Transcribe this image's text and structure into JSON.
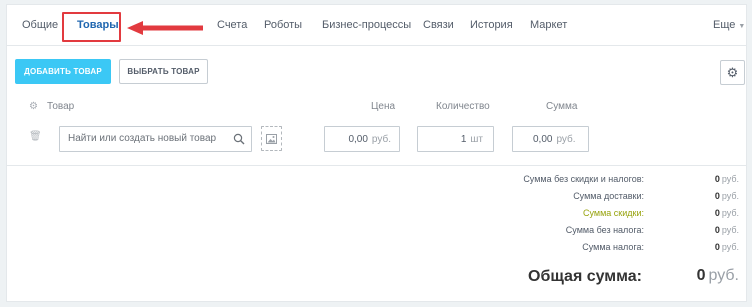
{
  "tabs": [
    {
      "label": "Общие",
      "active": false
    },
    {
      "label": "Товары",
      "active": true
    },
    {
      "label": "Счета",
      "active": false
    },
    {
      "label": "Роботы",
      "active": false
    },
    {
      "label": "Бизнес-процессы",
      "active": false
    },
    {
      "label": "Связи",
      "active": false
    },
    {
      "label": "История",
      "active": false
    },
    {
      "label": "Маркет",
      "active": false
    }
  ],
  "more_tab": {
    "label": "Еще",
    "icon": "caret-down-icon"
  },
  "annotation": {
    "highlight_color": "#e23a3f",
    "arrow_color": "#e23a3f"
  },
  "toolbar": {
    "add_label": "ДОБАВИТЬ ТОВАР",
    "select_label": "ВЫБРАТЬ ТОВАР",
    "settings_icon": "gear-icon"
  },
  "columns": {
    "product": "Товар",
    "price": "Цена",
    "quantity": "Количество",
    "sum": "Сумма"
  },
  "row": {
    "search_placeholder": "Найти или создать новый товар",
    "price": "0,00",
    "price_unit": "руб.",
    "quantity": "1",
    "quantity_unit": "шт",
    "sum": "0,00",
    "sum_unit": "руб."
  },
  "totals": {
    "items": [
      {
        "label": "Сумма без скидки и налогов:",
        "value": "0",
        "unit": "руб."
      },
      {
        "label": "Сумма доставки:",
        "value": "0",
        "unit": "руб."
      },
      {
        "label": "Сумма скидки:",
        "value": "0",
        "unit": "руб."
      },
      {
        "label": "Сумма без налога:",
        "value": "0",
        "unit": "руб."
      },
      {
        "label": "Сумма налога:",
        "value": "0",
        "unit": "руб."
      }
    ],
    "grand_label": "Общая сумма:",
    "grand_value": "0",
    "grand_unit": "руб."
  },
  "colors": {
    "accent": "#3bc8f5",
    "active_tab": "#2067b0",
    "discount_label": "#97a30d",
    "background": "#eef2f4"
  }
}
